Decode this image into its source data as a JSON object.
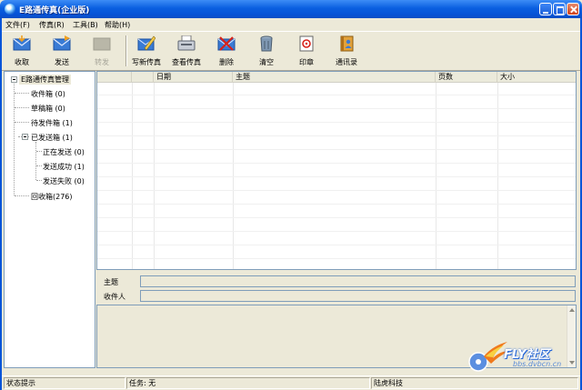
{
  "window": {
    "title": "E路通传真(企业版)"
  },
  "menu": [
    "文件(F)",
    "传真(R)",
    "工具(B)",
    "帮助(H)"
  ],
  "toolbar": [
    {
      "label": "收取",
      "icon": "receive-envelope-icon",
      "enabled": true
    },
    {
      "label": "发送",
      "icon": "send-envelope-icon",
      "enabled": true
    },
    {
      "label": "转发",
      "icon": "forward-icon",
      "enabled": false
    },
    {
      "label": "写新传真",
      "icon": "write-fax-icon",
      "enabled": true
    },
    {
      "label": "查看传真",
      "icon": "fax-machine-icon",
      "enabled": true
    },
    {
      "label": "删除",
      "icon": "delete-icon",
      "enabled": true
    },
    {
      "label": "清空",
      "icon": "trash-can-icon",
      "enabled": true
    },
    {
      "label": "印章",
      "icon": "stamp-icon",
      "enabled": true
    },
    {
      "label": "通讯录",
      "icon": "address-book-icon",
      "enabled": true
    }
  ],
  "tree": {
    "root": "E路通传真管理",
    "items": [
      {
        "label": "收件箱 (0)"
      },
      {
        "label": "草稿箱 (0)"
      },
      {
        "label": "待发件箱 (1)"
      },
      {
        "label": "已发送箱 (1)"
      },
      {
        "label": "正在发送 (0)"
      },
      {
        "label": "发送成功 (1)"
      },
      {
        "label": "发送失败 (0)"
      },
      {
        "label": "回收箱(276)"
      }
    ]
  },
  "list": {
    "columns": [
      "",
      "",
      "日期",
      "主题",
      "页数",
      "大小"
    ]
  },
  "detail": {
    "subject_label": "主题",
    "recipient_label": "收件人"
  },
  "watermark": {
    "text": "FLY社区",
    "url": "bbs.dvbcn.cn"
  },
  "status": {
    "hint": "状态提示",
    "task": "任务: 无",
    "company": "陆虎科技"
  },
  "colors": {
    "titlebar": "#0a5fe0",
    "window_bg": "#ece9d8",
    "border": "#7f9db9"
  }
}
